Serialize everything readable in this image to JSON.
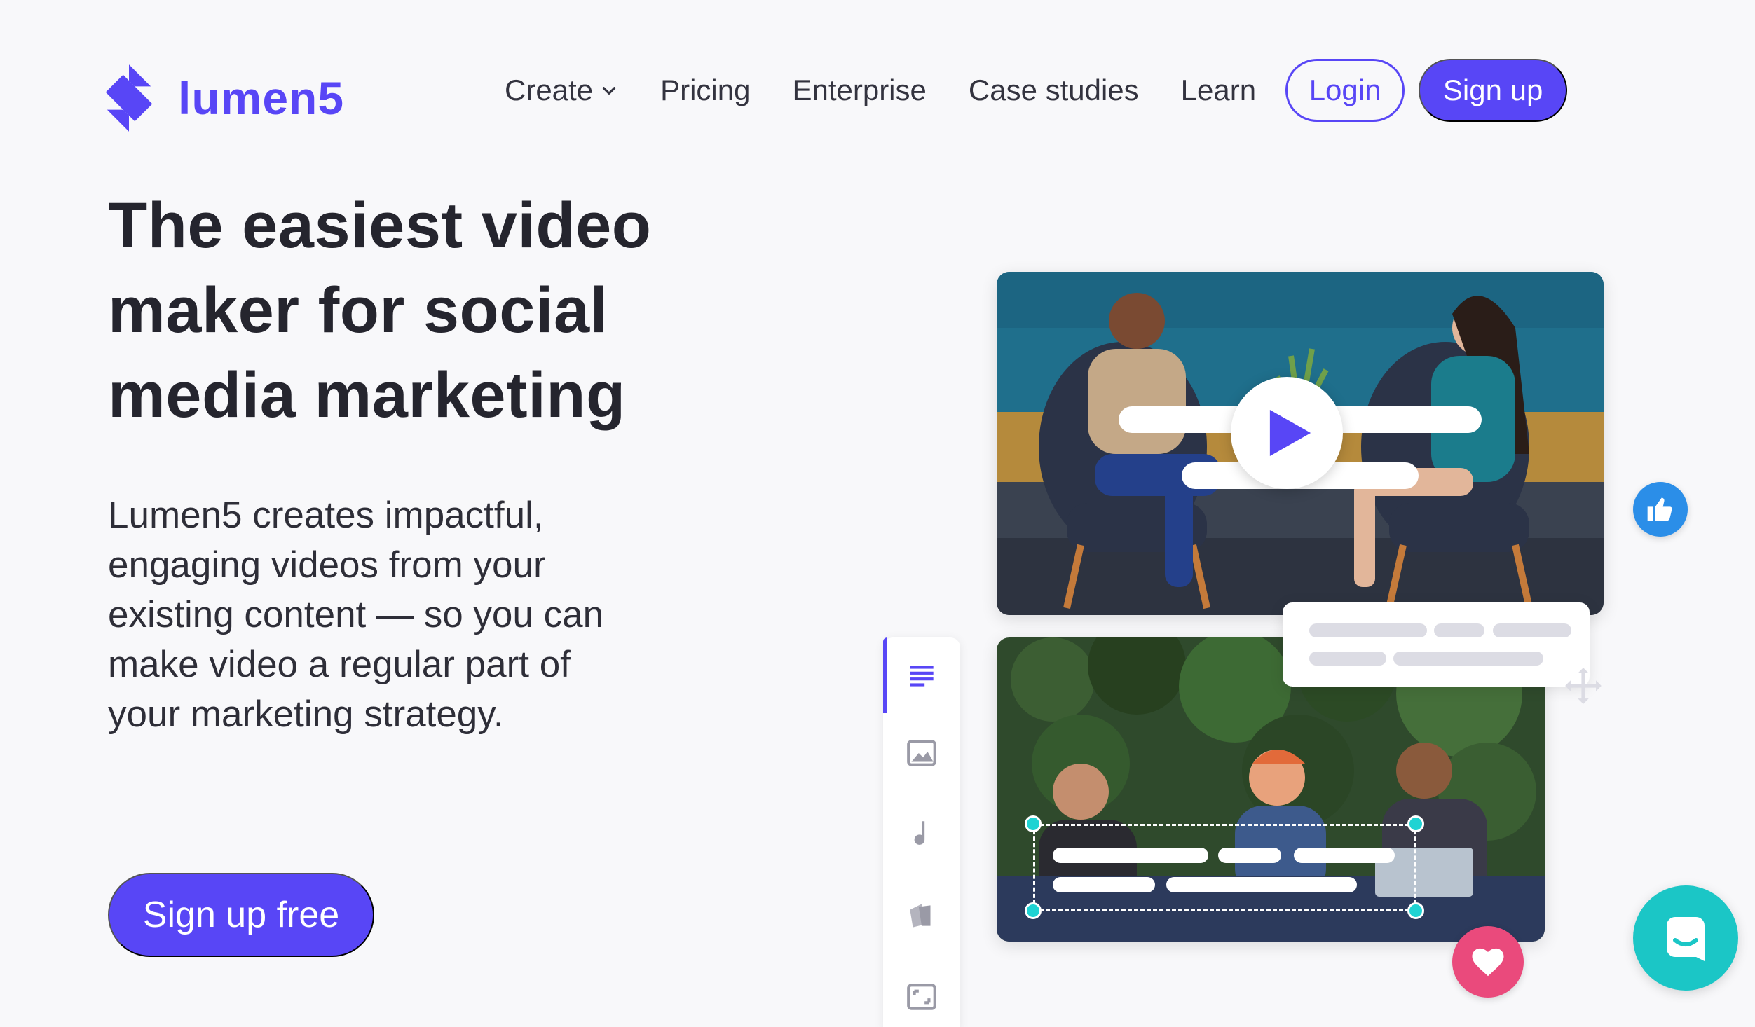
{
  "brand": {
    "name": "lumen5",
    "accent": "#5846f6"
  },
  "nav": {
    "create_label": "Create",
    "pricing_label": "Pricing",
    "enterprise_label": "Enterprise",
    "case_studies_label": "Case studies",
    "learn_label": "Learn",
    "login_label": "Login",
    "signup_label": "Sign up"
  },
  "hero": {
    "title": "The easiest video maker for social media marketing",
    "description": "Lumen5 creates impactful, engaging videos from your existing content — so you can make video a regular part of your marketing strategy.",
    "cta_label": "Sign up free"
  },
  "editor_sidebar": {
    "icons": [
      "text-lines-icon",
      "image-icon",
      "music-note-icon",
      "color-swatches-icon",
      "resize-frame-icon"
    ]
  },
  "colors": {
    "like_badge": "#2b8ee8",
    "heart_badge": "#ea4a7c",
    "chat_button": "#1bc6c6",
    "selection_handle": "#1fd3d3"
  }
}
